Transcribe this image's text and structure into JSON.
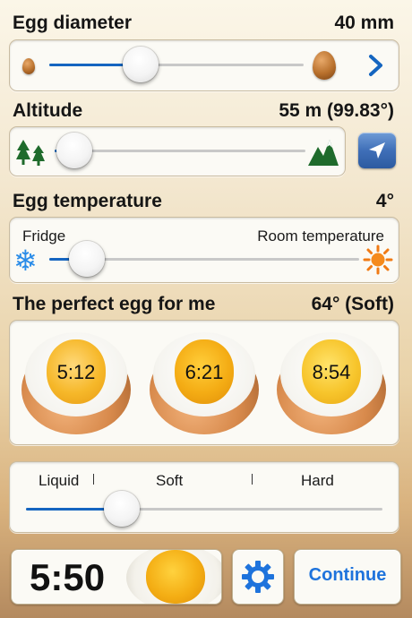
{
  "egg_diameter": {
    "title": "Egg diameter",
    "value": "40 mm",
    "level": 0.36
  },
  "altitude": {
    "title": "Altitude",
    "value": "55 m (99.83°)",
    "level": 0.08
  },
  "egg_temperature": {
    "title": "Egg temperature",
    "value": "4°",
    "min_label": "Fridge",
    "max_label": "Room temperature",
    "level": 0.12
  },
  "perfect_egg": {
    "title": "The perfect egg for me",
    "value": "64° (Soft)",
    "eggs": [
      {
        "time": "5:12"
      },
      {
        "time": "6:21"
      },
      {
        "time": "8:54"
      }
    ]
  },
  "consistency": {
    "liquid": "Liquid",
    "soft": "Soft",
    "hard": "Hard",
    "level": 0.27
  },
  "bottom": {
    "timer": "5:50",
    "continue_label": "Continue"
  },
  "colors": {
    "accent": "#1565c0",
    "fill": "#1565c0"
  }
}
